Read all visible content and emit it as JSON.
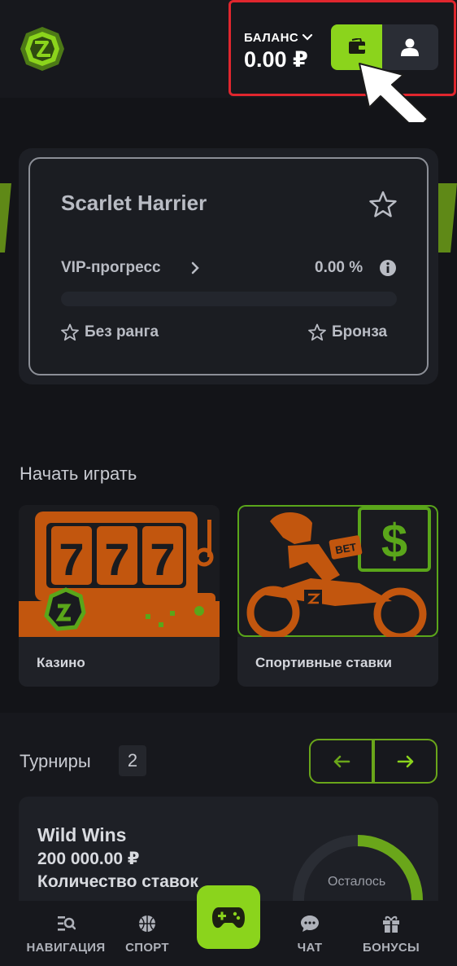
{
  "header": {
    "logo_icon": "emerald-logo-icon",
    "balance_label": "БАЛАНС",
    "balance_amount": "0.00 ₽",
    "wallet_icon": "wallet-icon",
    "profile_icon": "user-icon"
  },
  "vip_card": {
    "user_name": "Scarlet Harrier",
    "progress_label": "VIP-прогресс",
    "progress_value": "0.00 %",
    "progress_fraction": 0.0,
    "current_rank": "Без ранга",
    "next_rank": "Бронза"
  },
  "start_playing": {
    "title": "Начать играть",
    "cards": [
      {
        "label": "Казино",
        "icon": "slot-machine-icon"
      },
      {
        "label": "Спортивные ставки",
        "icon": "motocross-bet-icon"
      }
    ]
  },
  "tournaments": {
    "title": "Турниры",
    "count": "2",
    "prev_icon": "arrow-left-icon",
    "next_icon": "arrow-right-icon",
    "card": {
      "name": "Wild Wins",
      "prize": "200 000.00 ₽",
      "bets_label": "Количество ставок",
      "remaining_label": "Осталось"
    }
  },
  "bottom_nav": {
    "items": [
      {
        "label": "НАВИГАЦИЯ",
        "icon": "navigation-search-icon"
      },
      {
        "label": "СПОРТ",
        "icon": "basketball-icon"
      },
      {
        "label": "ЧАТ",
        "icon": "chat-bubble-icon"
      },
      {
        "label": "БОНУСЫ",
        "icon": "gift-icon"
      }
    ],
    "center_icon": "gamepad-icon"
  },
  "colors": {
    "accent": "#8bd41c",
    "background": "#131418",
    "highlight": "#e0262e"
  }
}
